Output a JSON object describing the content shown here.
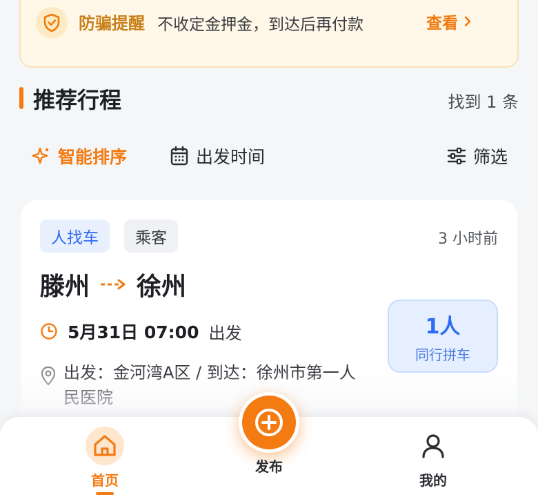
{
  "notice": {
    "title": "防骗提醒",
    "text": "不收定金押金，到达后再付款",
    "link": "查看"
  },
  "section": {
    "title": "推荐行程",
    "count": "找到 1 条"
  },
  "sort": {
    "smart": "智能排序",
    "time": "出发时间",
    "filter": "筛选"
  },
  "card": {
    "tag_role": "人找车",
    "tag_type": "乘客",
    "posted": "3 小时前",
    "from": "滕州",
    "to": "徐州",
    "date": "5月31日 07:00",
    "depart_suffix": "出发",
    "place": "出发：金河湾A区 / 到达：徐州市第一人民医院",
    "seats": "1人",
    "seats_label": "同行拼车"
  },
  "tabbar": {
    "home": "首页",
    "publish": "发布",
    "mine": "我的"
  },
  "colors": {
    "accent": "#f47a12",
    "blue": "#2d6cf2",
    "notice_bg": "#fff8e8"
  },
  "icons": [
    "shield-check-icon",
    "chevron-right-icon",
    "sparkle-icon",
    "calendar-icon",
    "sliders-icon",
    "arrow-right-icon",
    "clock-icon",
    "location-pin-icon",
    "home-icon",
    "plus-circle-icon",
    "user-icon"
  ]
}
